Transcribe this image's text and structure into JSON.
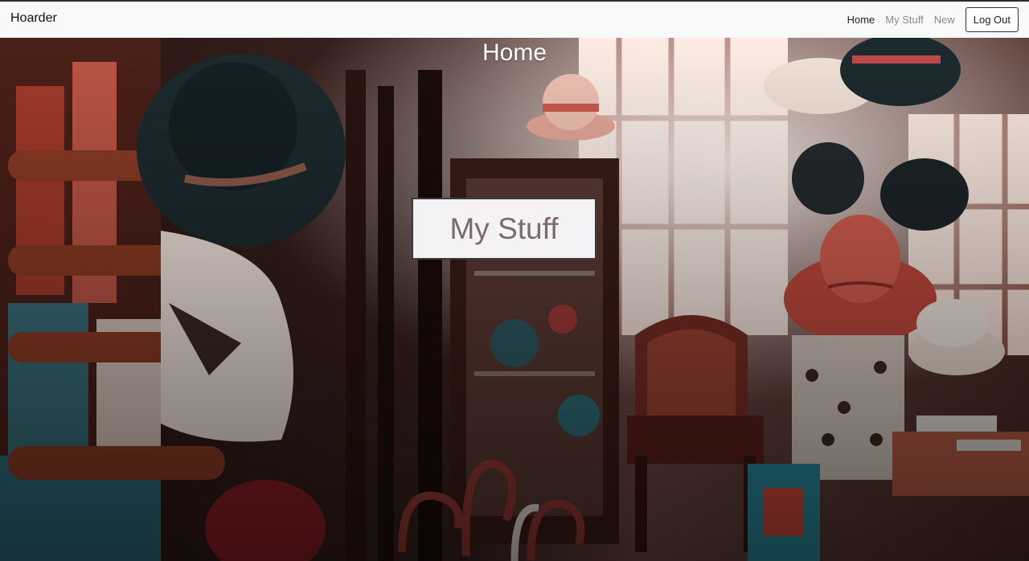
{
  "navbar": {
    "brand": "Hoarder",
    "links": [
      {
        "label": "Home",
        "active": true
      },
      {
        "label": "My Stuff",
        "active": false
      },
      {
        "label": "New",
        "active": false
      }
    ],
    "logout_label": "Log Out"
  },
  "hero": {
    "title": "Home",
    "button_label": "My Stuff"
  },
  "colors": {
    "navbar_bg": "#f8f9fa",
    "button_text": "#7a6a72",
    "title_text": "#ffffff"
  }
}
